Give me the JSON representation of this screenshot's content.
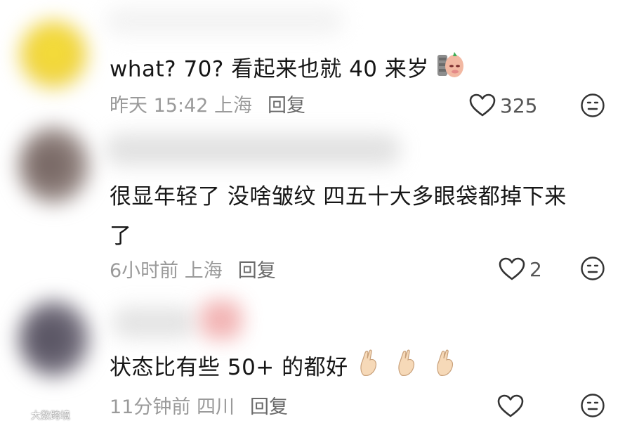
{
  "comments": [
    {
      "text": "what? 70? 看起来也就 40 来岁",
      "time_location": "昨天 15:42 上海",
      "reply_label": "回复",
      "likes": "325",
      "avatar_color": "#f2d73c"
    },
    {
      "text_line1": "很显年轻了 没啥皱纹 四五十大多眼袋都掉下来",
      "text_line2": "了",
      "time_location": "6小时前 上海",
      "reply_label": "回复",
      "likes": "2",
      "avatar_color": "#7a6a66"
    },
    {
      "text": "状态比有些 50+ 的都好",
      "time_location": "11分钟前 四川",
      "reply_label": "回复",
      "likes": "",
      "avatar_color": "#5c5866"
    }
  ],
  "watermark": {
    "text": "大数跨境"
  },
  "icons": {
    "like": "heart-outline-icon",
    "dislike": "neutral-face-icon",
    "emoji_1": "potato-sticker-icon",
    "emoji_3": "crossed-fingers-icon"
  }
}
